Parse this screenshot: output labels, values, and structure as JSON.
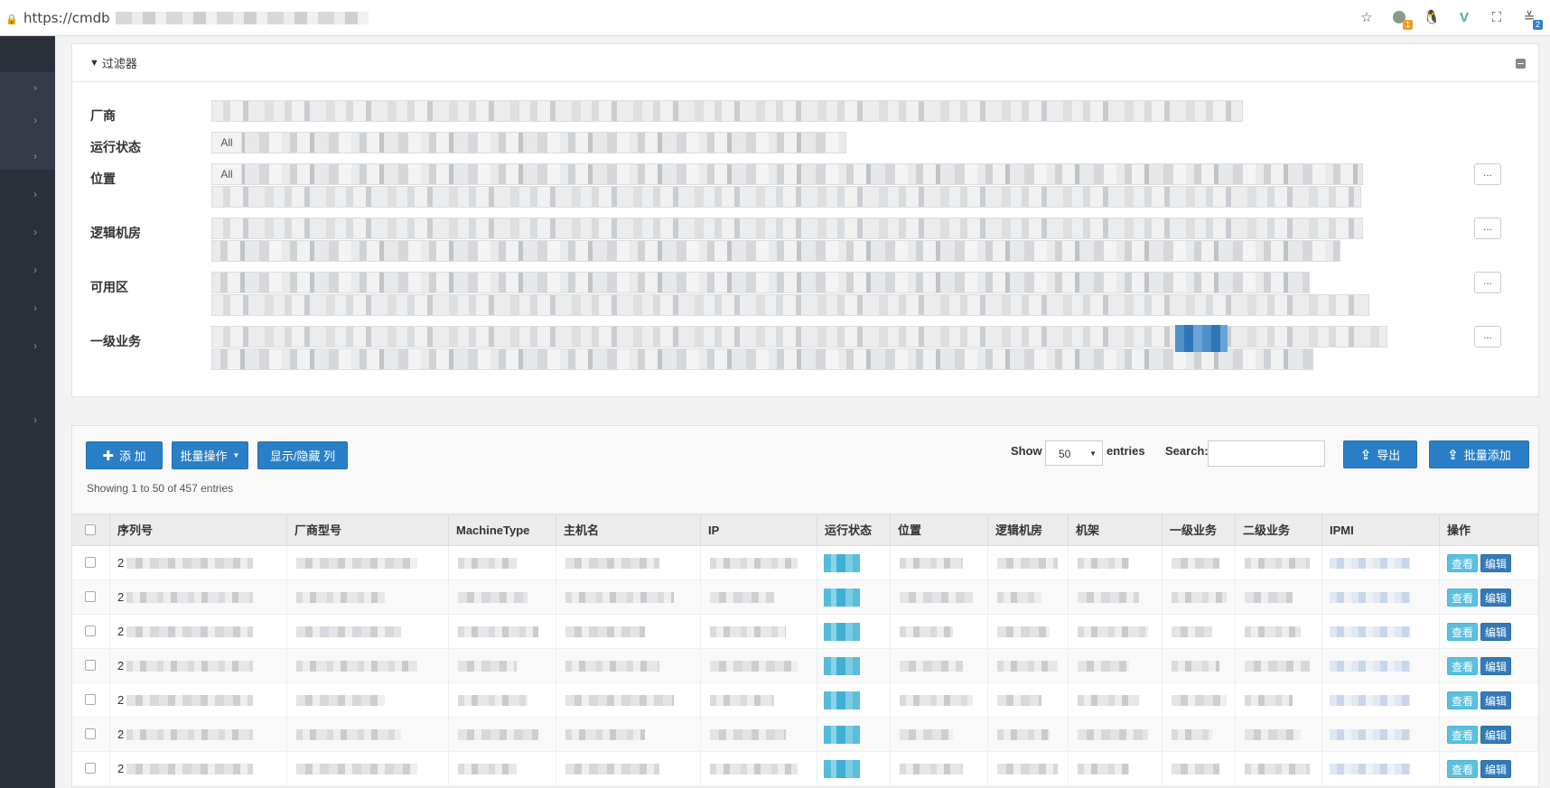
{
  "browser": {
    "url_prefix": "https://cmdb",
    "badge_1": "1",
    "badge_2": "2"
  },
  "sidebar": {
    "arrow_glyph": "›"
  },
  "filter": {
    "title": "过滤器",
    "rows": [
      {
        "label": "厂商"
      },
      {
        "label": "运行状态",
        "all_chip": "All"
      },
      {
        "label": "位置",
        "all_chip": "All",
        "more": "..."
      },
      {
        "label": "逻辑机房",
        "more": "..."
      },
      {
        "label": "可用区",
        "more": "..."
      },
      {
        "label": "一级业务",
        "more": "..."
      }
    ]
  },
  "toolbar": {
    "add_label": "添 加",
    "batch_ops_label": "批量操作",
    "toggle_cols_label": "显示/隐藏 列",
    "showing_text": "Showing 1 to 50 of 457 entries",
    "show_label": "Show",
    "page_size": "50",
    "entries_label": "entries",
    "search_label": "Search:",
    "export_label": "导出",
    "batch_add_label": "批量添加"
  },
  "table": {
    "columns": [
      "序列号",
      "厂商型号",
      "MachineType",
      "主机名",
      "IP",
      "运行状态",
      "位置",
      "逻辑机房",
      "机架",
      "一级业务",
      "二级业务",
      "IPMI",
      "操作"
    ],
    "rows": [
      {
        "serial_prefix": "2",
        "view": "查看",
        "edit": "编辑"
      },
      {
        "serial_prefix": "2",
        "view": "查看",
        "edit": "编辑"
      },
      {
        "serial_prefix": "2",
        "view": "查看",
        "edit": "编辑"
      },
      {
        "serial_prefix": "2",
        "view": "查看",
        "edit": "编辑"
      },
      {
        "serial_prefix": "2",
        "view": "查看",
        "edit": "编辑"
      },
      {
        "serial_prefix": "2",
        "view": "查看",
        "edit": "编辑"
      },
      {
        "serial_prefix": "2",
        "view": "查看",
        "edit": "编辑"
      }
    ]
  },
  "colors": {
    "sidebar": "#2b2f3a",
    "primary": "#2a7fc7",
    "info": "#5bc0de",
    "edit": "#337ab7"
  }
}
